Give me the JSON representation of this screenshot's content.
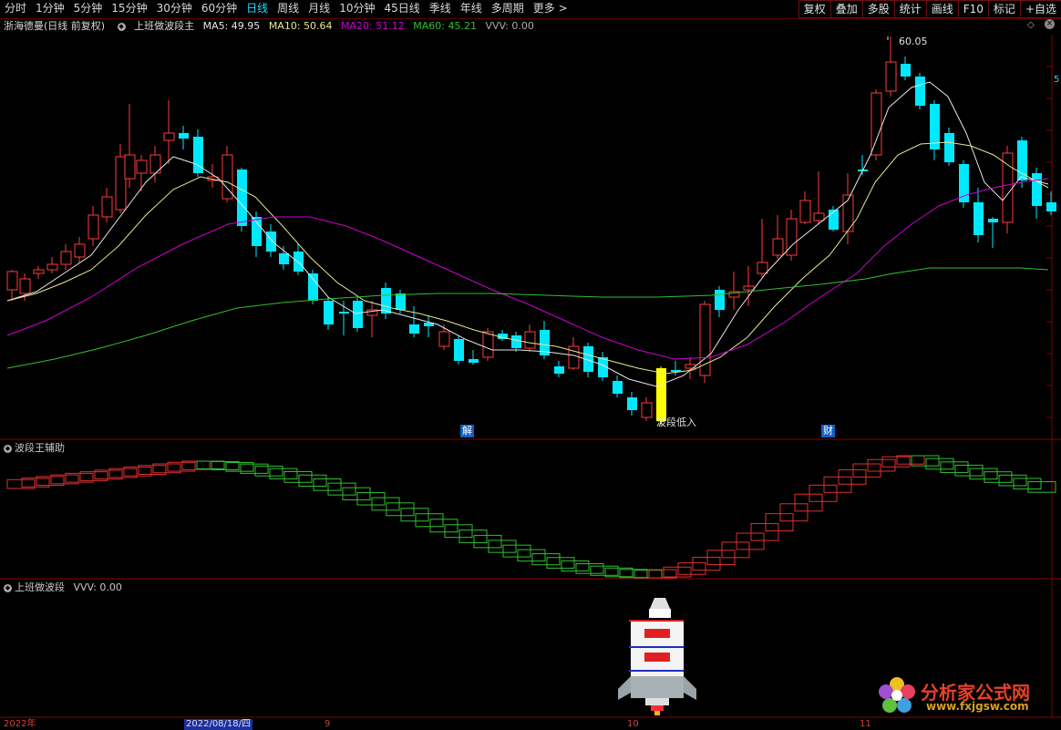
{
  "toolbar": {
    "tabs": [
      {
        "label": "分时"
      },
      {
        "label": "1分钟"
      },
      {
        "label": "5分钟"
      },
      {
        "label": "15分钟"
      },
      {
        "label": "30分钟"
      },
      {
        "label": "60分钟"
      },
      {
        "label": "日线",
        "active": true
      },
      {
        "label": "周线"
      },
      {
        "label": "月线"
      },
      {
        "label": "10分钟"
      },
      {
        "label": "45日线"
      },
      {
        "label": "季线"
      },
      {
        "label": "年线"
      },
      {
        "label": "多周期"
      },
      {
        "label": "更多 >"
      }
    ],
    "tools": [
      {
        "label": "复权"
      },
      {
        "label": "叠加"
      },
      {
        "label": "多股"
      },
      {
        "label": "统计"
      },
      {
        "label": "画线"
      },
      {
        "label": "F10"
      },
      {
        "label": "标记"
      },
      {
        "label": "+自选"
      }
    ]
  },
  "main_pane": {
    "stock_name": "浙海德曼(日线 前复权)",
    "indicator_name": "上班做波段主",
    "ma5": "MA5: 49.95",
    "ma10": "MA10: 50.64",
    "ma20": "MA20: 51.12",
    "ma60": "MA60: 45.21",
    "vvv": "VVV: 0.00",
    "high_label": "60.05",
    "signal_text": "波段低入",
    "marker_jie": "解",
    "marker_cai": "财",
    "right_edge_value": "5"
  },
  "sub_pane1": {
    "title": "波段王辅助"
  },
  "sub_pane2": {
    "title": "上班做波段",
    "vvv": "VVV: 0.00"
  },
  "date_axis": {
    "labels": [
      "2022年",
      "2022/08/18/四",
      "9",
      "10",
      "11"
    ]
  },
  "watermark": {
    "title": "分析家公式网",
    "url": "www.fxjgsw.com"
  },
  "colors": {
    "up": "#ff3c3c",
    "down": "#00e8ff",
    "ma5": "#e6e6e6",
    "ma10": "#e6e690",
    "ma20": "#d000d0",
    "ma60": "#30c030",
    "signal": "#ffff00",
    "grid": "#6a0000"
  },
  "chart_data": {
    "type": "candlestick",
    "price_high": 60.05,
    "ma_labels": [
      "MA5",
      "MA10",
      "MA20",
      "MA60"
    ],
    "ma_values": [
      49.95,
      50.64,
      51.12,
      45.21
    ]
  }
}
